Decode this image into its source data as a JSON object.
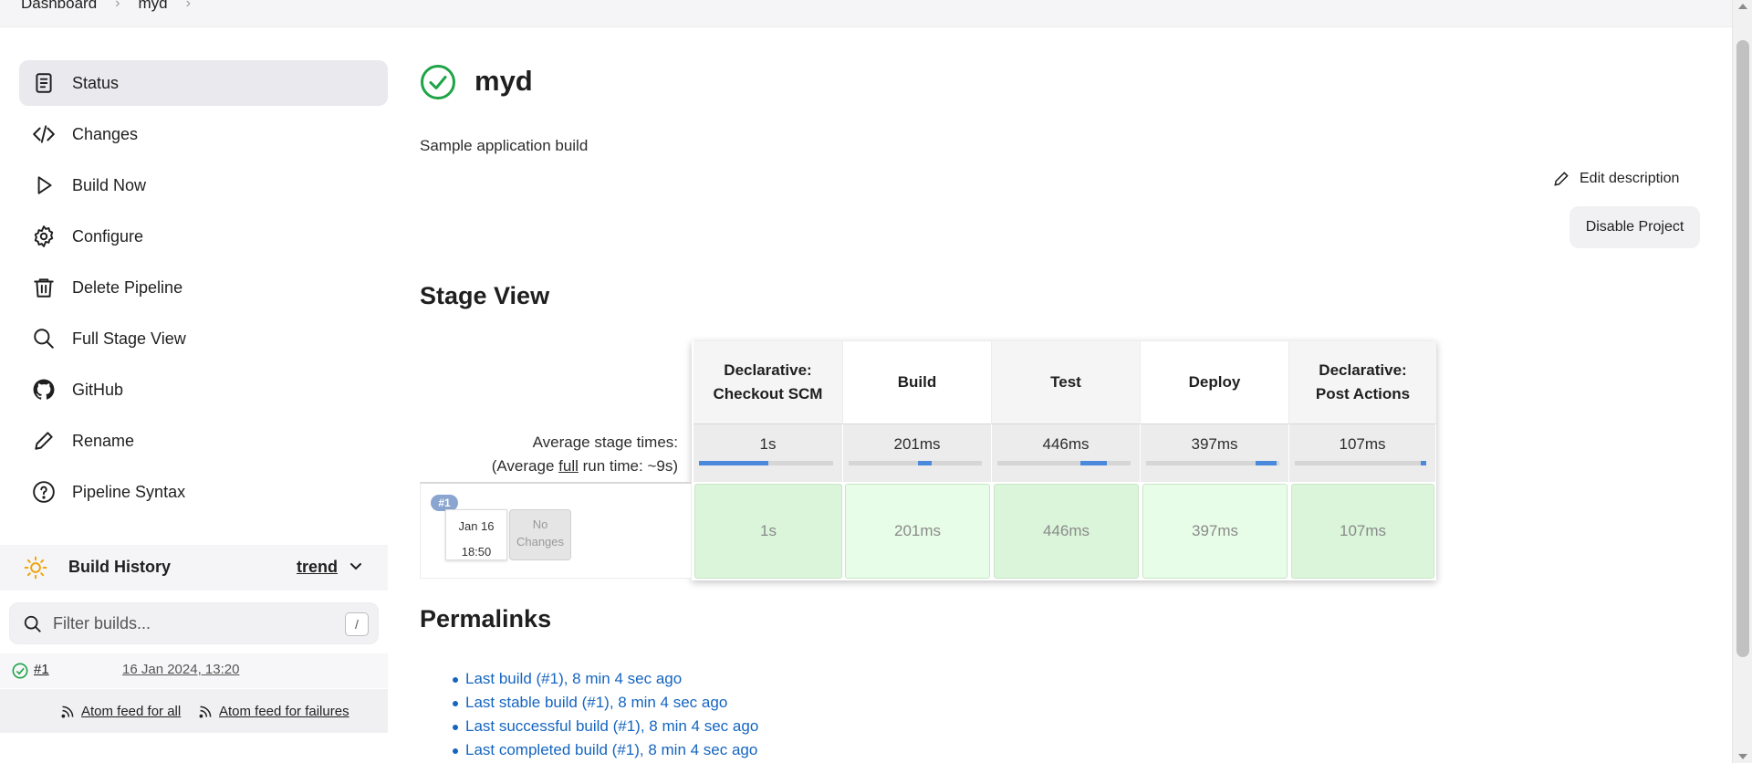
{
  "breadcrumb": {
    "items": [
      "Dashboard",
      "myd"
    ]
  },
  "sidebar": {
    "items": [
      {
        "label": "Status",
        "icon": "status-icon"
      },
      {
        "label": "Changes",
        "icon": "code-icon"
      },
      {
        "label": "Build Now",
        "icon": "play-icon"
      },
      {
        "label": "Configure",
        "icon": "gear-icon"
      },
      {
        "label": "Delete Pipeline",
        "icon": "trash-icon"
      },
      {
        "label": "Full Stage View",
        "icon": "search-icon"
      },
      {
        "label": "GitHub",
        "icon": "github-icon"
      },
      {
        "label": "Rename",
        "icon": "pencil-icon"
      },
      {
        "label": "Pipeline Syntax",
        "icon": "help-icon"
      }
    ]
  },
  "build_history": {
    "title": "Build History",
    "trend_label": "trend",
    "search_placeholder": "Filter builds...",
    "shortcut_key": "/",
    "builds": [
      {
        "number": "#1",
        "date": "16 Jan 2024, 13:20",
        "status_color": "#1ea446"
      }
    ],
    "feeds": {
      "all": "Atom feed for all",
      "failures": "Atom feed for failures"
    }
  },
  "project": {
    "name": "myd",
    "description": "Sample application build",
    "status_color": "#1ea446",
    "edit_description_label": "Edit description",
    "disable_label": "Disable Project"
  },
  "stage_view": {
    "title": "Stage View",
    "avg_label_line1": "Average stage times:",
    "avg_label_pre": "(Average ",
    "avg_label_full": "full",
    "avg_label_post": " run time: ~9s)",
    "stages": [
      {
        "name_line1": "Declarative:",
        "name_line2": "Checkout SCM",
        "avg": "1s",
        "run_time": "1s"
      },
      {
        "name_line1": "Build",
        "name_line2": "",
        "avg": "201ms",
        "run_time": "201ms"
      },
      {
        "name_line1": "Test",
        "name_line2": "",
        "avg": "446ms",
        "run_time": "446ms"
      },
      {
        "name_line1": "Deploy",
        "name_line2": "",
        "avg": "397ms",
        "run_time": "397ms"
      },
      {
        "name_line1": "Declarative:",
        "name_line2": "Post Actions",
        "avg": "107ms",
        "run_time": "107ms"
      }
    ],
    "run": {
      "badge": "#1",
      "date": "Jan 16",
      "time": "18:50",
      "changes": "No Changes"
    },
    "success_color": "#dbf5da"
  },
  "permalinks": {
    "title": "Permalinks",
    "links": [
      "Last build (#1), 8 min 4 sec ago",
      "Last stable build (#1), 8 min 4 sec ago",
      "Last successful build (#1), 8 min 4 sec ago",
      "Last completed build (#1), 8 min 4 sec ago"
    ]
  }
}
